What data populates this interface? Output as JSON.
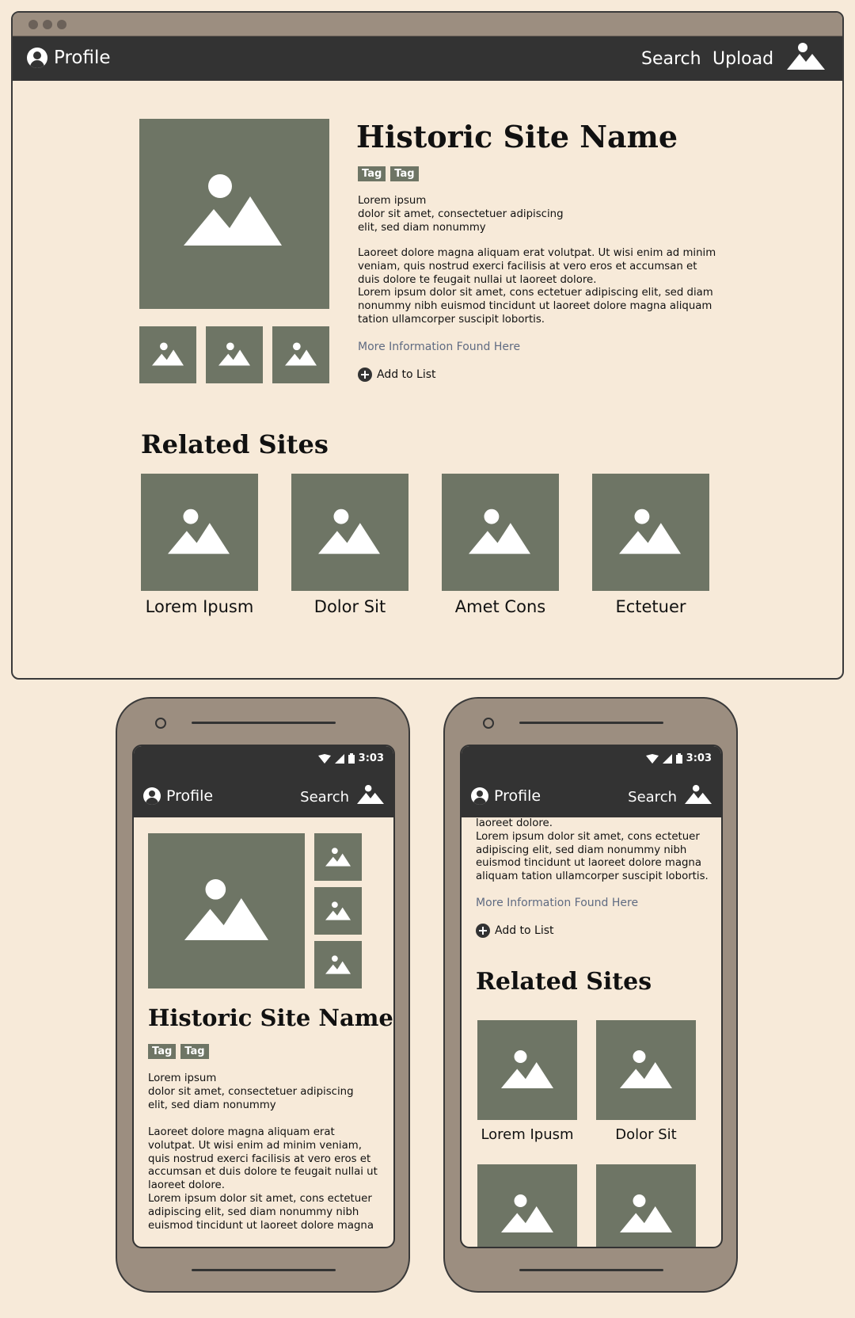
{
  "desktop": {
    "nav": {
      "profile_label": "Profile",
      "search_label": "Search",
      "upload_label": "Upload"
    },
    "site": {
      "title": "Historic Site Name",
      "tags": [
        "Tag",
        "Tag"
      ],
      "intro_lines": [
        "Lorem ipsum",
        "dolor sit amet, consectetuer adipiscing",
        "elit, sed diam nonummy"
      ],
      "body_lines": [
        "Laoreet dolore magna aliquam erat volutpat. Ut wisi enim ad minim",
        "veniam, quis nostrud exerci facilisis at vero eros et accumsan et",
        "duis dolore te feugait nullai ut laoreet dolore.",
        "Lorem ipsum dolor sit amet, cons ectetuer adipiscing elit, sed diam",
        "nonummy nibh euismod tincidunt ut laoreet dolore magna aliquam",
        "tation ullamcorper suscipit lobortis."
      ],
      "more_info_link": "More Information Found Here",
      "add_to_list_label": "Add to List"
    },
    "related": {
      "title": "Related Sites",
      "items": [
        "Lorem Ipusm",
        "Dolor Sit",
        "Amet Cons",
        "Ectetuer"
      ]
    }
  },
  "phone_left": {
    "status_time": "3:03",
    "nav": {
      "profile_label": "Profile",
      "search_label": "Search"
    },
    "site": {
      "title": "Historic Site Name",
      "tags": [
        "Tag",
        "Tag"
      ],
      "intro_lines": [
        "Lorem ipsum",
        "dolor sit amet, consectetuer adipiscing",
        "elit, sed diam nonummy"
      ],
      "body_lines": [
        "Laoreet dolore magna aliquam erat",
        "volutpat. Ut wisi enim ad minim veniam,",
        "quis nostrud exerci facilisis at vero eros et",
        "accumsan et duis dolore te feugait nullai ut",
        "laoreet dolore.",
        "Lorem ipsum dolor sit amet, cons ectetuer",
        "adipiscing elit, sed diam nonummy nibh",
        "euismod tincidunt ut laoreet dolore magna"
      ]
    }
  },
  "phone_right": {
    "status_time": "3:03",
    "nav": {
      "profile_label": "Profile",
      "search_label": "Search"
    },
    "body_lines": [
      "laoreet dolore.",
      "Lorem ipsum dolor sit amet, cons ectetuer",
      "adipiscing elit, sed diam nonummy nibh",
      "euismod tincidunt ut laoreet dolore magna",
      "aliquam tation ullamcorper suscipit lobortis."
    ],
    "more_info_link": "More Information Found Here",
    "add_to_list_label": "Add to List",
    "related": {
      "title": "Related Sites",
      "items": [
        "Lorem Ipusm",
        "Dolor Sit"
      ]
    }
  },
  "colors": {
    "background": "#f7ead9",
    "navbar": "#333333",
    "placeholder": "#6e7565",
    "device_frame": "#9c8e80",
    "link": "#5f6b82"
  }
}
